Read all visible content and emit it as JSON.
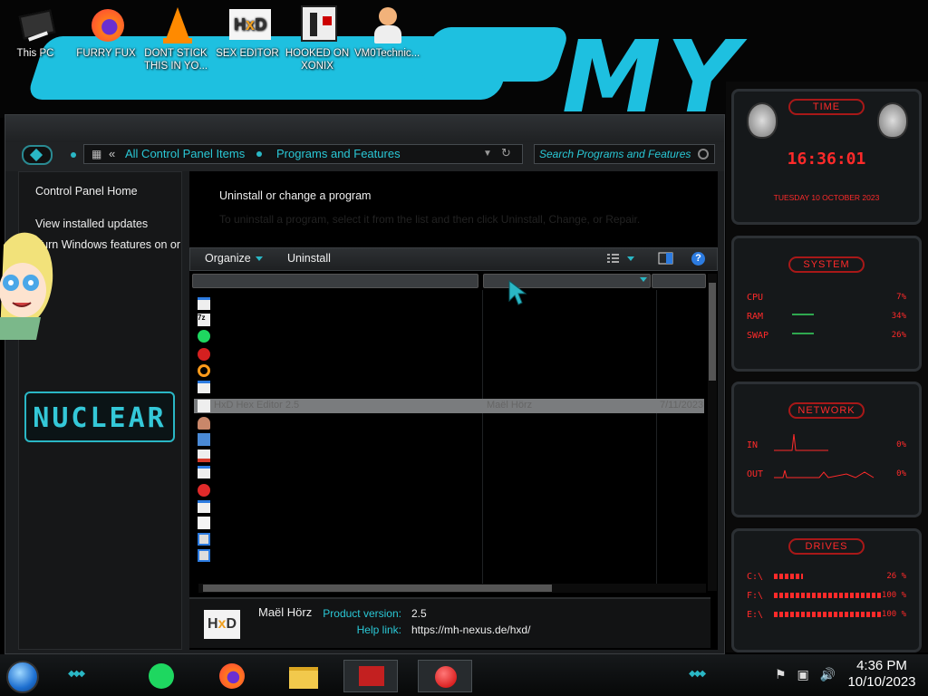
{
  "desktop": {
    "wallpaper_text": "MY BEAST",
    "icons": [
      {
        "label": "This PC",
        "icon": "computer-icon"
      },
      {
        "label": "FURRY FUX",
        "icon": "firefox-icon"
      },
      {
        "label": "DONT STICK THIS IN YO...",
        "icon": "vlc-icon"
      },
      {
        "label": "SEX EDITOR",
        "icon": "hxd-icon"
      },
      {
        "label": "HOOKED ON XONIX",
        "icon": "xonix-icon"
      },
      {
        "label": "VM0Technic...",
        "icon": "doctor-icon"
      }
    ]
  },
  "window": {
    "address": {
      "crumbs": [
        "All Control Panel Items",
        "Programs and Features"
      ]
    },
    "search_placeholder": "Search Programs and Features",
    "sidepane": {
      "links": [
        "Control Panel Home",
        "View installed updates",
        "Turn Windows features on or off"
      ],
      "logo_text": "NUCLEAR"
    },
    "content": {
      "title": "Uninstall or change a program",
      "subtitle": "To uninstall a program, select it from the list and then click Uninstall, Change, or Repair."
    },
    "commandbar": {
      "organize": "Organize",
      "uninstall": "Uninstall",
      "help": "?"
    },
    "list": {
      "selected": {
        "name": "HxD Hex Editor 2.5",
        "publisher": "Maël Hörz",
        "installed_on": "7/11/2023"
      },
      "icons": [
        "window-icon",
        "7zip-icon",
        "spotify-icon",
        "devcpp-icon",
        "search-magnifier-icon",
        "window-icon",
        "hxd-icon",
        "person-icon",
        "network-icon",
        "java-icon",
        "window-icon",
        "red-app-icon",
        "window-icon",
        "document-icon",
        "installer-icon",
        "installer-icon"
      ]
    },
    "details": {
      "publisher": "Maël Hörz",
      "product_version_label": "Product version:",
      "product_version": "2.5",
      "help_link_label": "Help link:",
      "help_link": "https://mh-nexus.de/hxd/"
    }
  },
  "gadgets": {
    "time": {
      "title": "TIME",
      "clock": "16:36:01",
      "date": "TUESDAY 10 OCTOBER 2023"
    },
    "system": {
      "title": "SYSTEM",
      "rows": [
        {
          "label": "CPU",
          "value": "7%"
        },
        {
          "label": "RAM",
          "value": "34%"
        },
        {
          "label": "SWAP",
          "value": "26%"
        }
      ]
    },
    "network": {
      "title": "NETWORK",
      "rows": [
        {
          "label": "IN",
          "value": "0%"
        },
        {
          "label": "OUT",
          "value": "0%"
        }
      ]
    },
    "drives": {
      "title": "DRIVES",
      "rows": [
        {
          "label": "C:\\",
          "value": "26 %"
        },
        {
          "label": "F:\\",
          "value": "100 %"
        },
        {
          "label": "E:\\",
          "value": "100 %"
        }
      ]
    },
    "accent": "#ff2a2a"
  },
  "taskbar": {
    "apps": [
      "spotify-icon",
      "firefox-icon",
      "file-explorer-icon",
      "hxd-icon",
      "red-button-icon"
    ],
    "tray_icons": [
      "flag-icon",
      "network-icon",
      "volume-icon"
    ],
    "time": "4:36 PM",
    "date": "10/10/2023"
  },
  "colors": {
    "accent": "#2ab7c5",
    "panel": "#1b1d1f",
    "alert": "#ff2a2a"
  }
}
